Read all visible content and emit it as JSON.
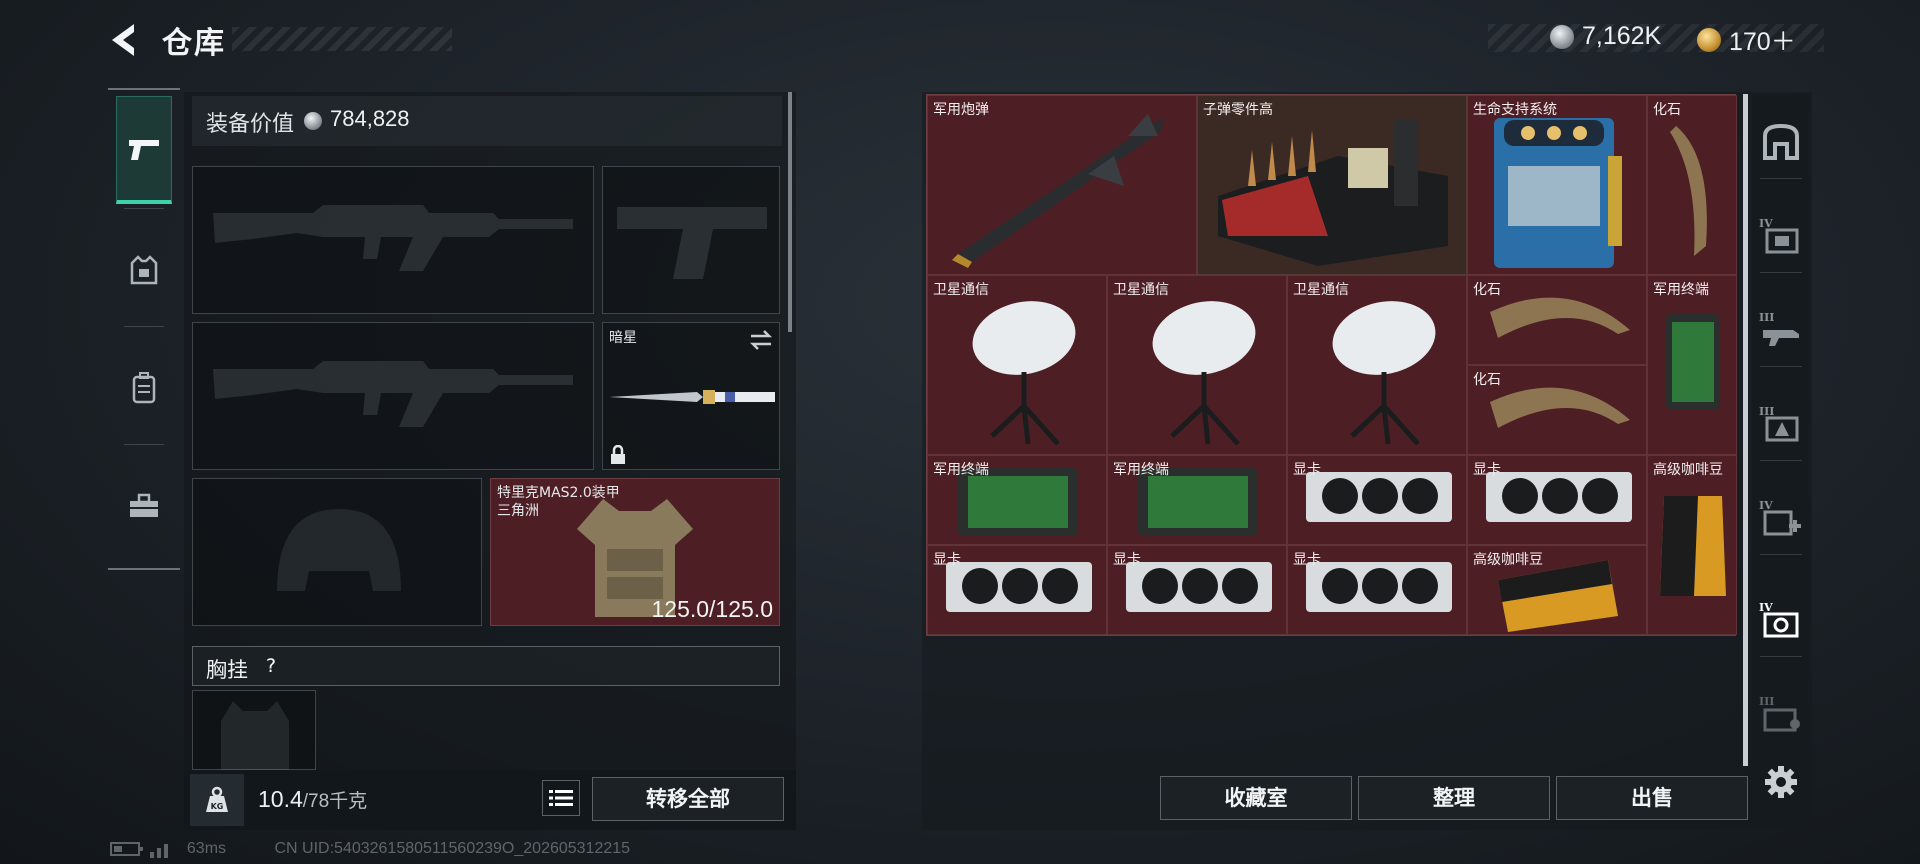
{
  "header": {
    "title": "仓库",
    "silver_amount": "7,162K",
    "gold_amount": "170＋"
  },
  "categories": [
    {
      "icon": "pistol-icon",
      "active": true
    },
    {
      "icon": "vest-icon",
      "active": false
    },
    {
      "icon": "backpack-icon",
      "active": false
    },
    {
      "icon": "toolbox-icon",
      "active": false
    }
  ],
  "loadout": {
    "value_label": "装备价值",
    "value": "784,828",
    "melee_slot_label": "暗星",
    "armor_name": "特里克MAS2.0装甲",
    "armor_origin": "三角洲",
    "armor_durability": "125.0/125.0",
    "chest_label": "胸挂",
    "help_glyph": "?",
    "weight_value": "10.4",
    "weight_max": "/78千克",
    "transfer_all_label": "转移全部"
  },
  "storage": {
    "items": [
      {
        "id": "missile",
        "label": "军用炮弹"
      },
      {
        "id": "bullet-parts",
        "label": "子弹零件高"
      },
      {
        "id": "life-support",
        "label": "生命支持系统"
      },
      {
        "id": "fossil-1",
        "label": "化石"
      },
      {
        "id": "satcom-1",
        "label": "卫星通信"
      },
      {
        "id": "satcom-2",
        "label": "卫星通信"
      },
      {
        "id": "satcom-3",
        "label": "卫星通信"
      },
      {
        "id": "fossil-2",
        "label": "化石"
      },
      {
        "id": "military-terminal-1",
        "label": "军用终端"
      },
      {
        "id": "fossil-3",
        "label": "化石"
      },
      {
        "id": "military-terminal-2",
        "label": "军用终端"
      },
      {
        "id": "military-terminal-3",
        "label": "军用终端"
      },
      {
        "id": "gpu-1",
        "label": "显卡"
      },
      {
        "id": "gpu-2",
        "label": "显卡"
      },
      {
        "id": "coffee-1",
        "label": "高级咖啡豆"
      },
      {
        "id": "gpu-3",
        "label": "显卡"
      },
      {
        "id": "gpu-4",
        "label": "显卡"
      },
      {
        "id": "gpu-5",
        "label": "显卡"
      },
      {
        "id": "coffee-2",
        "label": "高级咖啡豆"
      }
    ],
    "buttons": {
      "collection": "收藏室",
      "organize": "整理",
      "sell": "出售"
    },
    "tabs": [
      {
        "icon": "vault-icon"
      },
      {
        "icon": "tier-iv-case-icon",
        "tier": "IV"
      },
      {
        "icon": "tier-iii-weapon-case-icon",
        "tier": "III"
      },
      {
        "icon": "tier-iii-ammo-case-icon",
        "tier": "III"
      },
      {
        "icon": "tier-iv-medical-case-icon",
        "tier": "IV"
      },
      {
        "icon": "tier-iv-container-icon",
        "tier": "IV",
        "active": true
      },
      {
        "icon": "tier-iii-key-case-icon",
        "tier": "III"
      },
      {
        "icon": "gear-icon"
      }
    ]
  },
  "status_bar": {
    "ping": "63ms",
    "uid": "CN UID:5403261580511560239O_202605312215"
  },
  "colors": {
    "accent": "#3fd1a8",
    "item_cell": "#4d1f24",
    "background": "#1c2228"
  }
}
